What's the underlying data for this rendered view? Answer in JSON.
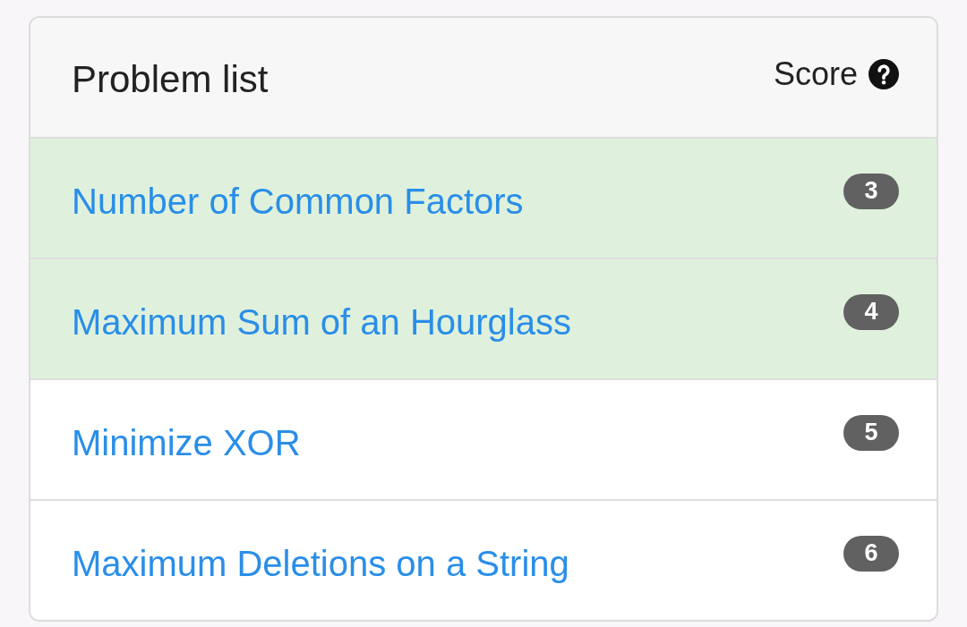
{
  "header": {
    "title": "Problem list",
    "score_label": "Score"
  },
  "problems": [
    {
      "title": "Number of Common Factors",
      "score": "3",
      "solved": true
    },
    {
      "title": "Maximum Sum of an Hourglass",
      "score": "4",
      "solved": true
    },
    {
      "title": "Minimize XOR",
      "score": "5",
      "solved": false
    },
    {
      "title": "Maximum Deletions on a String",
      "score": "6",
      "solved": false
    }
  ]
}
